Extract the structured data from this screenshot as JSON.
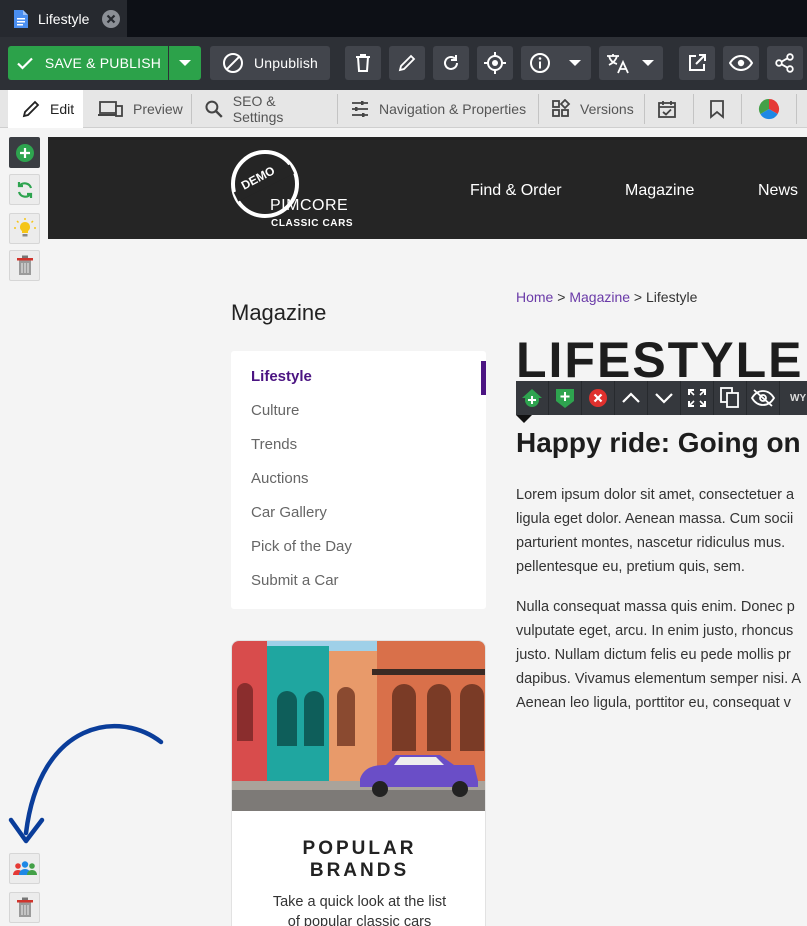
{
  "doc_tab": {
    "title": "Lifestyle",
    "icon": "document-icon"
  },
  "toolbar": {
    "save_publish": "SAVE & PUBLISH",
    "unpublish": "Unpublish"
  },
  "subtabs": {
    "edit": "Edit",
    "preview": "Preview",
    "seo": "SEO & Settings",
    "navigation": "Navigation & Properties",
    "versions": "Versions"
  },
  "site": {
    "logo": {
      "demo": "DEMO",
      "brand": "PIMCORE",
      "sub": "CLASSIC CARS"
    },
    "nav": [
      "Find & Order",
      "Magazine",
      "News"
    ]
  },
  "breadcrumb": {
    "home": "Home",
    "sep1": " > ",
    "magazine": "Magazine",
    "sep2": " > ",
    "current": "Lifestyle"
  },
  "sidebar": {
    "title": "Magazine",
    "items": [
      "Lifestyle",
      "Culture",
      "Trends",
      "Auctions",
      "Car Gallery",
      "Pick of the Day",
      "Submit a Car"
    ]
  },
  "promo": {
    "title_line1": "POPULAR",
    "title_line2": "BRANDS",
    "desc_line1": "Take a quick look at the list",
    "desc_line2": "of popular classic cars"
  },
  "article": {
    "heading": "LIFESTYLE",
    "subheading": "Happy ride: Going on a",
    "p1": [
      "Lorem ipsum dolor sit amet, consectetuer a",
      "ligula eget dolor. Aenean massa. Cum socii",
      "parturient montes, nascetur ridiculus mus. ",
      "pellentesque eu, pretium quis, sem."
    ],
    "p2": [
      "Nulla consequat massa quis enim. Donec p",
      "vulputate eget, arcu. In enim justo, rhoncus",
      "justo. Nullam dictum felis eu pede mollis pr",
      "dapibus. Vivamus elementum semper nisi. A",
      "Aenean leo ligula, porttitor eu, consequat v"
    ]
  },
  "editbar": {
    "wysiwyg_label": "WY"
  },
  "colors": {
    "accent_green": "#2ca24a",
    "menu_active": "#4b1482",
    "link": "#6a3aa8",
    "toolbar": "#2d3036"
  }
}
